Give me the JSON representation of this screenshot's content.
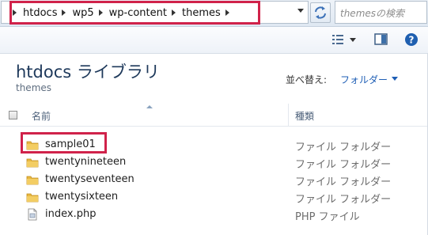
{
  "address_bar": {
    "crumbs": [
      "htdocs",
      "wp5",
      "wp-content",
      "themes"
    ],
    "search_placeholder": "themesの検索"
  },
  "toolbar": {
    "view_icon": "view-options-icon",
    "preview_icon": "preview-pane-icon",
    "help_icon": "help-icon"
  },
  "library": {
    "title": "htdocs ライブラリ",
    "subtitle": "themes",
    "sort_label": "並べ替え:",
    "sort_value": "フォルダー"
  },
  "columns": {
    "name": "名前",
    "type": "種類"
  },
  "files": [
    {
      "name": "sample01",
      "type": "ファイル フォルダー",
      "icon": "folder-icon"
    },
    {
      "name": "twentynineteen",
      "type": "ファイル フォルダー",
      "icon": "folder-icon"
    },
    {
      "name": "twentyseventeen",
      "type": "ファイル フォルダー",
      "icon": "folder-icon"
    },
    {
      "name": "twentysixteen",
      "type": "ファイル フォルダー",
      "icon": "folder-icon"
    },
    {
      "name": "index.php",
      "type": "PHP ファイル",
      "icon": "php-file-icon"
    }
  ],
  "colors": {
    "highlight": "#d0224a",
    "title": "#1e395b",
    "accent": "#1e5eb5"
  }
}
